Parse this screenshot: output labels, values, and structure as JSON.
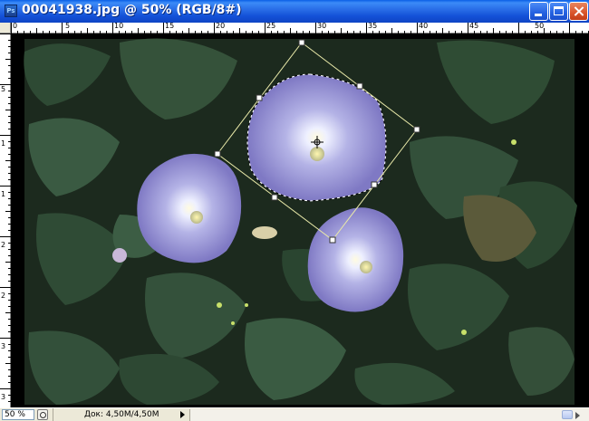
{
  "window": {
    "title": "00041938.jpg @  50% (RGB/8#)",
    "app_icon": "photoshop-document-icon",
    "buttons": {
      "minimize": "minimize-icon",
      "maximize": "maximize-icon",
      "close": "close-icon"
    }
  },
  "rulers": {
    "top_labels": [
      "0",
      "5",
      "10",
      "15",
      "20",
      "25",
      "30",
      "35",
      "40",
      "45",
      "50"
    ],
    "left_labels": [
      "5",
      "1",
      "1",
      "2",
      "2",
      "3",
      "3"
    ]
  },
  "canvas": {
    "image": "Morning glory flowers on green leaves",
    "selection": "marching-ants lasso around top flower with transform bounding box",
    "center_marker": "crosshair-icon"
  },
  "status": {
    "zoom": "50 %",
    "doc_info": "Док: 4,50M/4,50M",
    "nav_icon": "status-navigator-icon",
    "menu_arrow": "triangle-right-icon"
  },
  "colors": {
    "titlebar": "#1452d8",
    "close_button": "#d9542a",
    "background": "#ece9d8",
    "flower": "#8b85c9",
    "leaf": "#2f4c33"
  }
}
